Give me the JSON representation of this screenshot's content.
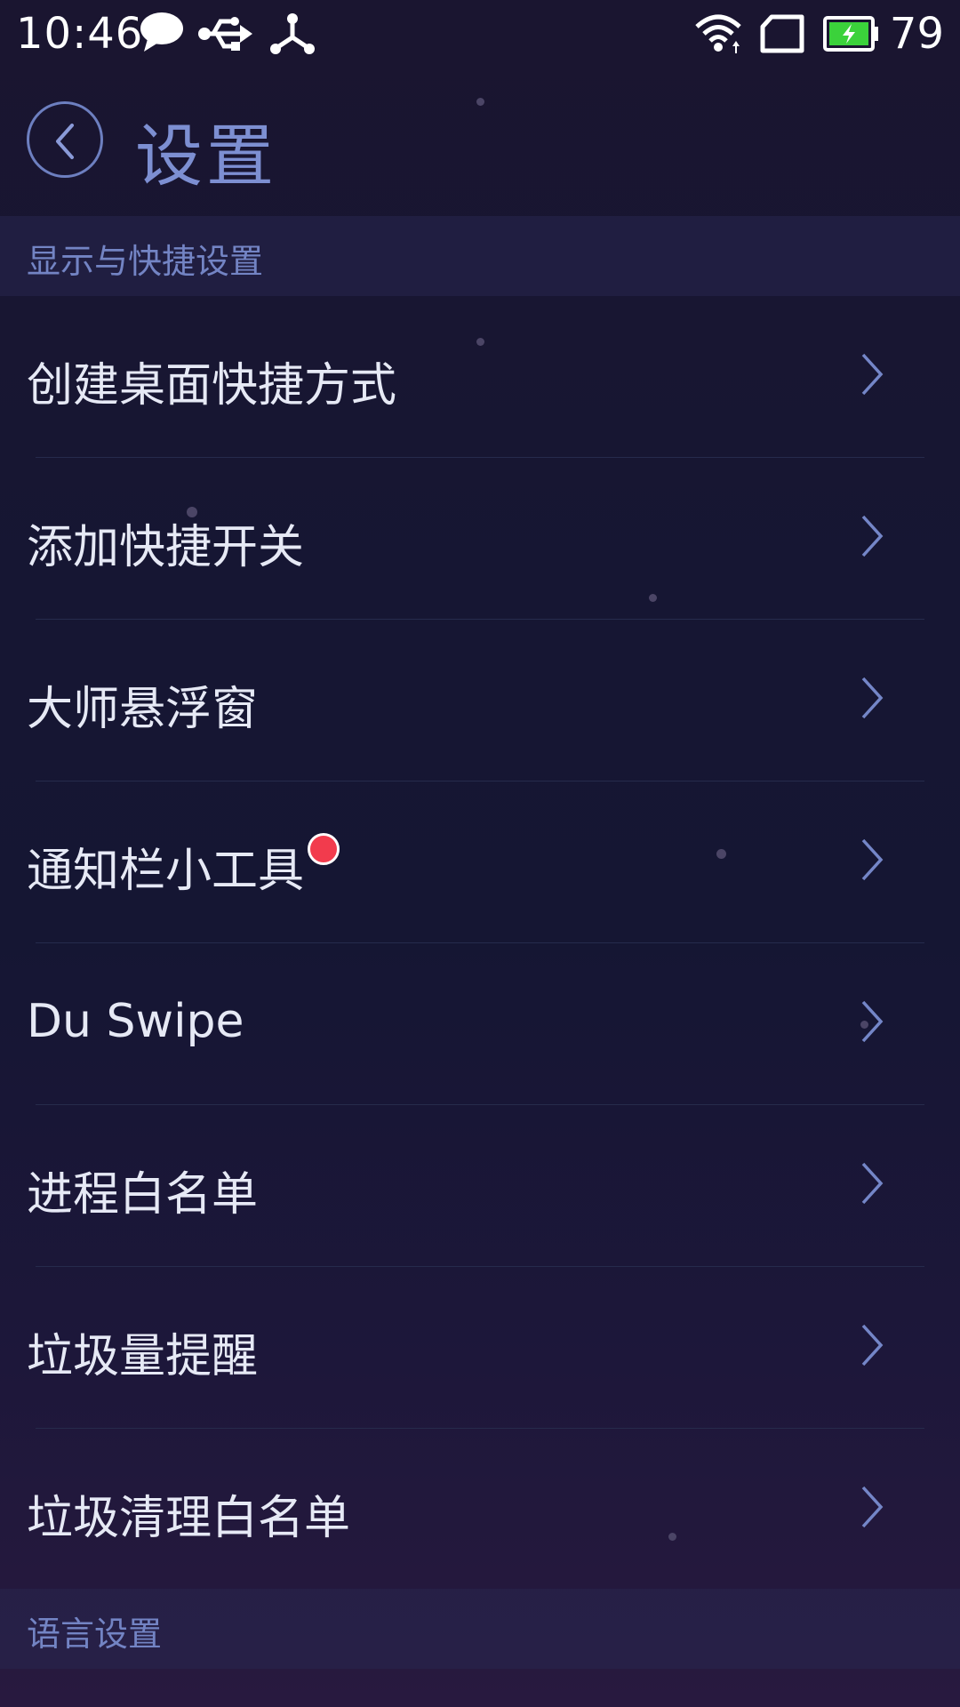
{
  "status_bar": {
    "time": "10:46",
    "battery_level": "79",
    "icons": [
      "chat-bubble-icon",
      "usb-icon",
      "share-node-icon",
      "wifi-icon",
      "sim-card-icon",
      "battery-charging-icon"
    ],
    "battery_color": "#3bd23b"
  },
  "header": {
    "title": "设置",
    "back_icon": "chevron-left-icon"
  },
  "sections": [
    {
      "title": "显示与快捷设置",
      "items": [
        {
          "label": "创建桌面快捷方式"
        },
        {
          "label": "添加快捷开关"
        },
        {
          "label": "大师悬浮窗"
        },
        {
          "label": "通知栏小工具",
          "badge": "red-dot"
        },
        {
          "label": "Du Swipe"
        },
        {
          "label": "进程白名单"
        },
        {
          "label": "垃圾量提醒"
        },
        {
          "label": "垃圾清理白名单"
        }
      ]
    },
    {
      "title": "语言设置",
      "items": []
    }
  ],
  "colors": {
    "accent": "#7d8fd2",
    "section_text": "#7384c4",
    "item_text": "#e6e9f5",
    "badge": "#f23b4d"
  }
}
